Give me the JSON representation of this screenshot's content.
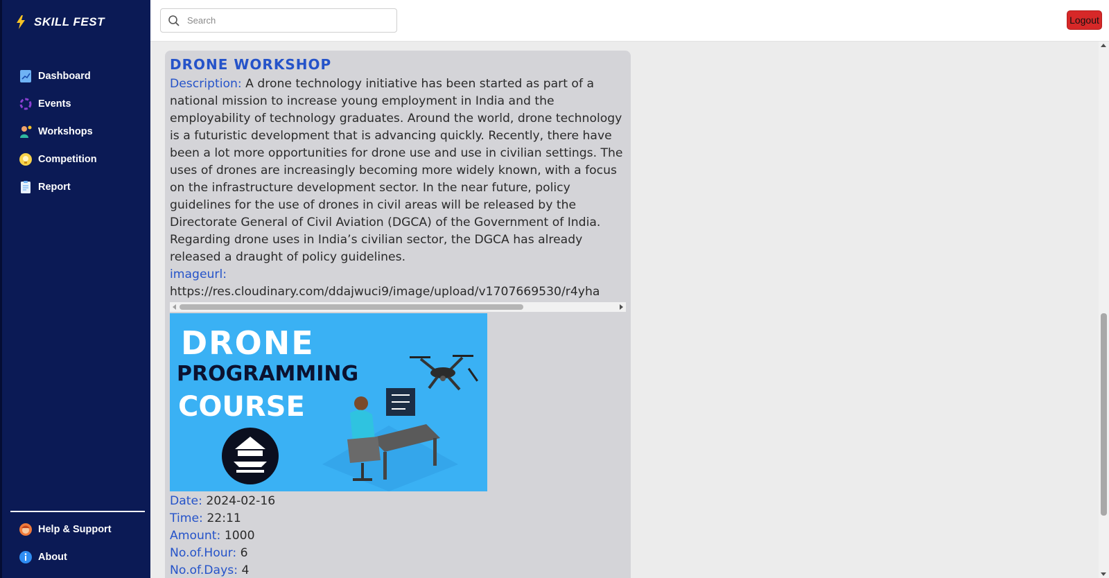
{
  "brand": {
    "name": "SKILL FEST",
    "icon": "lightning-bolt-icon"
  },
  "sidebar": {
    "items": [
      {
        "label": "Dashboard",
        "icon": "chart-icon"
      },
      {
        "label": "Events",
        "icon": "events-icon"
      },
      {
        "label": "Workshops",
        "icon": "workshop-person-icon"
      },
      {
        "label": "Competition",
        "icon": "lightbulb-icon"
      },
      {
        "label": "Report",
        "icon": "clipboard-icon"
      }
    ],
    "bottom_items": [
      {
        "label": "Help & Support",
        "icon": "support-person-icon"
      },
      {
        "label": "About",
        "icon": "info-icon"
      }
    ]
  },
  "topbar": {
    "search_placeholder": "Search",
    "logout_label": "Logout"
  },
  "workshop": {
    "title": "DRONE WORKSHOP",
    "description_label": "Description:",
    "description": "A drone technology initiative has been started as part of a national mission to increase young employment in India and the employability of technology graduates. Around the world, drone technology is a futuristic development that is advancing quickly. Recently, there have been a lot more opportunities for drone use and use in civilian settings. The uses of drones are increasingly becoming more widely known, with a focus on the infrastructure development sector. In the near future, policy guidelines for the use of drones in civil areas will be released by the Directorate General of Civil Aviation (DGCA) of the Government of India. Regarding drone uses in India’s civilian sector, the DGCA has already released a draught of policy guidelines.",
    "imageurl_label": "imageurl:",
    "imageurl": "https://res.cloudinary.com/ddajwuci9/image/upload/v1707669530/r4yha",
    "image": {
      "line1": "DRONE",
      "line2": "PROGRAMMING",
      "line3": "COURSE",
      "background": "#3ab1f4"
    },
    "date_label": "Date:",
    "date": "2024-02-16",
    "time_label": "Time:",
    "time": "22:11",
    "amount_label": "Amount:",
    "amount": "1000",
    "hours_label": "No.of.Hour:",
    "hours": "6",
    "days_label": "No.of.Days:",
    "days": "4"
  },
  "colors": {
    "sidebar_bg": "#0b1a55",
    "accent": "#2553c9",
    "logout": "#d62828",
    "card_bg": "#d4d4d8"
  }
}
